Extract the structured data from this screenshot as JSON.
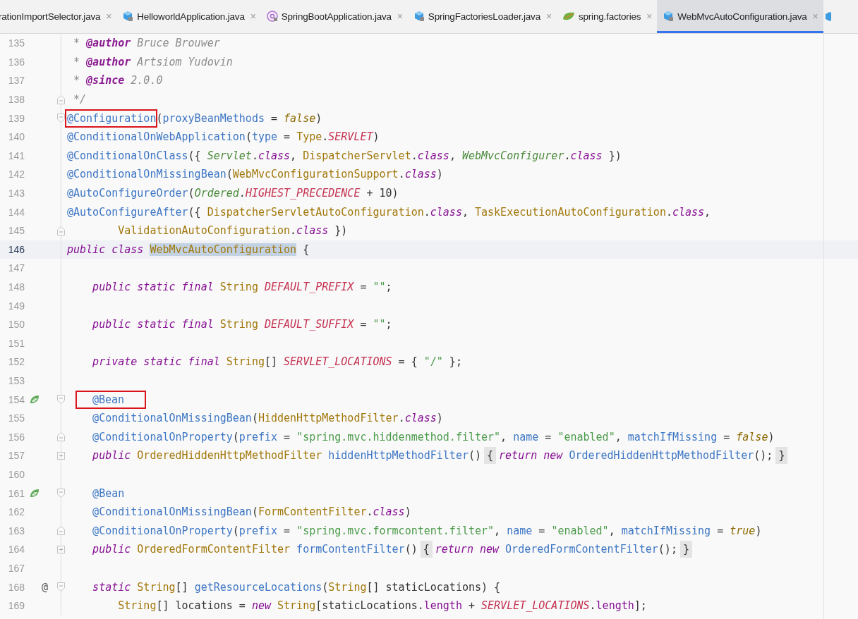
{
  "tabs": [
    {
      "label": "rationImportSelector.java",
      "kind": "none",
      "selected": false
    },
    {
      "label": "HelloworldApplication.java",
      "kind": "class",
      "selected": false
    },
    {
      "label": "SpringBootApplication.java",
      "kind": "annotation",
      "selected": false
    },
    {
      "label": "SpringFactoriesLoader.java",
      "kind": "class",
      "selected": false
    },
    {
      "label": "spring.factories",
      "kind": "spring",
      "selected": false
    },
    {
      "label": "WebMvcAutoConfiguration.java",
      "kind": "class",
      "selected": true
    }
  ],
  "close_glyph": "×",
  "lines": [
    {
      "number": "135",
      "current": false,
      "tokens": [
        {
          "text": " * ",
          "kind": "comment"
        },
        {
          "text": "@author",
          "kind": "doctag"
        },
        {
          "text": " Bruce Brouwer",
          "kind": "comment"
        }
      ]
    },
    {
      "number": "136",
      "current": false,
      "tokens": [
        {
          "text": " * ",
          "kind": "comment"
        },
        {
          "text": "@author",
          "kind": "doctag"
        },
        {
          "text": " Artsiom Yudovin",
          "kind": "comment"
        }
      ]
    },
    {
      "number": "137",
      "current": false,
      "tokens": [
        {
          "text": " * ",
          "kind": "comment"
        },
        {
          "text": "@since",
          "kind": "doctag"
        },
        {
          "text": " 2.0.0",
          "kind": "comment"
        }
      ]
    },
    {
      "number": "138",
      "current": false,
      "fold": {
        "kind": "end"
      },
      "tokens": [
        {
          "text": " */",
          "kind": "comment"
        }
      ]
    },
    {
      "number": "139",
      "current": false,
      "fold": {
        "kind": "start"
      },
      "tokens": [
        {
          "text": "@Configuration",
          "kind": "annotation-marked"
        },
        {
          "text": "(",
          "kind": "plain"
        },
        {
          "text": "proxyBeanMethods",
          "kind": "param"
        },
        {
          "text": " = ",
          "kind": "plain"
        },
        {
          "text": "false",
          "kind": "literal"
        },
        {
          "text": ")",
          "kind": "plain"
        }
      ]
    },
    {
      "number": "140",
      "current": false,
      "tokens": [
        {
          "text": "@ConditionalOnWebApplication",
          "kind": "annotation"
        },
        {
          "text": "(",
          "kind": "plain"
        },
        {
          "text": "type",
          "kind": "param"
        },
        {
          "text": " = ",
          "kind": "plain"
        },
        {
          "text": "Type",
          "kind": "type"
        },
        {
          "text": ".",
          "kind": "plain"
        },
        {
          "text": "SERVLET",
          "kind": "constant"
        },
        {
          "text": ")",
          "kind": "plain"
        }
      ]
    },
    {
      "number": "141",
      "current": false,
      "tokens": [
        {
          "text": "@ConditionalOnClass",
          "kind": "annotation"
        },
        {
          "text": "({ ",
          "kind": "plain"
        },
        {
          "text": "Servlet",
          "kind": "interface"
        },
        {
          "text": ".",
          "kind": "plain"
        },
        {
          "text": "class",
          "kind": "keyword"
        },
        {
          "text": ", ",
          "kind": "plain"
        },
        {
          "text": "DispatcherServlet",
          "kind": "type"
        },
        {
          "text": ".",
          "kind": "plain"
        },
        {
          "text": "class",
          "kind": "keyword"
        },
        {
          "text": ", ",
          "kind": "plain"
        },
        {
          "text": "WebMvcConfigurer",
          "kind": "interface"
        },
        {
          "text": ".",
          "kind": "plain"
        },
        {
          "text": "class",
          "kind": "keyword"
        },
        {
          "text": " })",
          "kind": "plain"
        }
      ]
    },
    {
      "number": "142",
      "current": false,
      "tokens": [
        {
          "text": "@ConditionalOnMissingBean",
          "kind": "annotation"
        },
        {
          "text": "(",
          "kind": "plain"
        },
        {
          "text": "WebMvcConfigurationSupport",
          "kind": "type"
        },
        {
          "text": ".",
          "kind": "plain"
        },
        {
          "text": "class",
          "kind": "keyword"
        },
        {
          "text": ")",
          "kind": "plain"
        }
      ]
    },
    {
      "number": "143",
      "current": false,
      "tokens": [
        {
          "text": "@AutoConfigureOrder",
          "kind": "annotation"
        },
        {
          "text": "(",
          "kind": "plain"
        },
        {
          "text": "Ordered",
          "kind": "interface"
        },
        {
          "text": ".",
          "kind": "plain"
        },
        {
          "text": "HIGHEST_PRECEDENCE",
          "kind": "constant"
        },
        {
          "text": " + ",
          "kind": "plain"
        },
        {
          "text": "10",
          "kind": "number"
        },
        {
          "text": ")",
          "kind": "plain"
        }
      ]
    },
    {
      "number": "144",
      "current": false,
      "tokens": [
        {
          "text": "@AutoConfigureAfter",
          "kind": "annotation"
        },
        {
          "text": "({ ",
          "kind": "plain"
        },
        {
          "text": "DispatcherServletAutoConfiguration",
          "kind": "type"
        },
        {
          "text": ".",
          "kind": "plain"
        },
        {
          "text": "class",
          "kind": "keyword"
        },
        {
          "text": ", ",
          "kind": "plain"
        },
        {
          "text": "TaskExecutionAutoConfiguration",
          "kind": "type"
        },
        {
          "text": ".",
          "kind": "plain"
        },
        {
          "text": "class",
          "kind": "keyword"
        },
        {
          "text": ",",
          "kind": "plain"
        }
      ]
    },
    {
      "number": "145",
      "current": false,
      "fold": {
        "kind": "end"
      },
      "tokens": [
        {
          "text": "        ValidationAutoConfiguration",
          "kind": "type"
        },
        {
          "text": ".",
          "kind": "plain"
        },
        {
          "text": "class",
          "kind": "keyword"
        },
        {
          "text": " })",
          "kind": "plain"
        }
      ]
    },
    {
      "number": "146",
      "current": true,
      "tokens": [
        {
          "text": "public class ",
          "kind": "keyword"
        },
        {
          "text": "WebMvcAutoConfiguration",
          "kind": "selected-type"
        },
        {
          "text": " {",
          "kind": "plain"
        }
      ]
    },
    {
      "number": "147",
      "current": false
    },
    {
      "number": "148",
      "current": false,
      "tokens": [
        {
          "text": "    public static final ",
          "kind": "keyword"
        },
        {
          "text": "String",
          "kind": "type"
        },
        {
          "text": " DEFAULT_PREFIX",
          "kind": "constant"
        },
        {
          "text": " = ",
          "kind": "plain"
        },
        {
          "text": "\"\"",
          "kind": "string"
        },
        {
          "text": ";",
          "kind": "plain"
        }
      ]
    },
    {
      "number": "149",
      "current": false
    },
    {
      "number": "150",
      "current": false,
      "tokens": [
        {
          "text": "    public static final ",
          "kind": "keyword"
        },
        {
          "text": "String",
          "kind": "type"
        },
        {
          "text": " DEFAULT_SUFFIX",
          "kind": "constant"
        },
        {
          "text": " = ",
          "kind": "plain"
        },
        {
          "text": "\"\"",
          "kind": "string"
        },
        {
          "text": ";",
          "kind": "plain"
        }
      ]
    },
    {
      "number": "151",
      "current": false
    },
    {
      "number": "152",
      "current": false,
      "tokens": [
        {
          "text": "    private static final ",
          "kind": "keyword"
        },
        {
          "text": "String",
          "kind": "type"
        },
        {
          "text": "[] ",
          "kind": "plain"
        },
        {
          "text": "SERVLET_LOCATIONS",
          "kind": "constant"
        },
        {
          "text": " = { ",
          "kind": "plain"
        },
        {
          "text": "\"/\"",
          "kind": "string"
        },
        {
          "text": " };",
          "kind": "plain"
        }
      ]
    },
    {
      "number": "153",
      "current": false
    },
    {
      "number": "154",
      "current": false,
      "gutter_icon": {
        "kind": "bean"
      },
      "fold": {
        "kind": "start"
      },
      "tokens": [
        {
          "text": "@Bean",
          "kind": "annotation-marked-indented"
        }
      ]
    },
    {
      "number": "155",
      "current": false,
      "tokens": [
        {
          "text": "    @ConditionalOnMissingBean",
          "kind": "annotation"
        },
        {
          "text": "(",
          "kind": "plain"
        },
        {
          "text": "HiddenHttpMethodFilter",
          "kind": "type"
        },
        {
          "text": ".",
          "kind": "plain"
        },
        {
          "text": "class",
          "kind": "keyword"
        },
        {
          "text": ")",
          "kind": "plain"
        }
      ]
    },
    {
      "number": "156",
      "current": false,
      "fold": {
        "kind": "end"
      },
      "tokens": [
        {
          "text": "    @ConditionalOnProperty",
          "kind": "annotation"
        },
        {
          "text": "(",
          "kind": "plain"
        },
        {
          "text": "prefix",
          "kind": "param"
        },
        {
          "text": " = ",
          "kind": "plain"
        },
        {
          "text": "\"spring.mvc.hiddenmethod.filter\"",
          "kind": "string"
        },
        {
          "text": ", ",
          "kind": "plain"
        },
        {
          "text": "name",
          "kind": "param"
        },
        {
          "text": " = ",
          "kind": "plain"
        },
        {
          "text": "\"enabled\"",
          "kind": "string"
        },
        {
          "text": ", ",
          "kind": "plain"
        },
        {
          "text": "matchIfMissing",
          "kind": "param"
        },
        {
          "text": " = ",
          "kind": "plain"
        },
        {
          "text": "false",
          "kind": "literal"
        },
        {
          "text": ")",
          "kind": "plain"
        }
      ]
    },
    {
      "number": "157",
      "current": false,
      "fold": {
        "kind": "collapsed"
      },
      "tokens": [
        {
          "text": "    public ",
          "kind": "keyword"
        },
        {
          "text": "OrderedHiddenHttpMethodFilter",
          "kind": "type"
        },
        {
          "text": " hiddenHttpMethodFilter",
          "kind": "method"
        },
        {
          "text": "()",
          "kind": "plain"
        },
        {
          "text": "{",
          "kind": "fold-brace"
        },
        {
          "text": "return new ",
          "kind": "keyword"
        },
        {
          "text": "OrderedHiddenHttpMethodFilter",
          "kind": "method"
        },
        {
          "text": "();",
          "kind": "plain"
        },
        {
          "text": "}",
          "kind": "fold-brace"
        }
      ]
    },
    {
      "number": "160",
      "current": false
    },
    {
      "number": "161",
      "current": false,
      "gutter_icon": {
        "kind": "bean"
      },
      "fold": {
        "kind": "start"
      },
      "tokens": [
        {
          "text": "    @Bean",
          "kind": "annotation"
        }
      ]
    },
    {
      "number": "162",
      "current": false,
      "tokens": [
        {
          "text": "    @ConditionalOnMissingBean",
          "kind": "annotation"
        },
        {
          "text": "(",
          "kind": "plain"
        },
        {
          "text": "FormContentFilter",
          "kind": "type"
        },
        {
          "text": ".",
          "kind": "plain"
        },
        {
          "text": "class",
          "kind": "keyword"
        },
        {
          "text": ")",
          "kind": "plain"
        }
      ]
    },
    {
      "number": "163",
      "current": false,
      "fold": {
        "kind": "end"
      },
      "tokens": [
        {
          "text": "    @ConditionalOnProperty",
          "kind": "annotation"
        },
        {
          "text": "(",
          "kind": "plain"
        },
        {
          "text": "prefix",
          "kind": "param"
        },
        {
          "text": " = ",
          "kind": "plain"
        },
        {
          "text": "\"spring.mvc.formcontent.filter\"",
          "kind": "string"
        },
        {
          "text": ", ",
          "kind": "plain"
        },
        {
          "text": "name",
          "kind": "param"
        },
        {
          "text": " = ",
          "kind": "plain"
        },
        {
          "text": "\"enabled\"",
          "kind": "string"
        },
        {
          "text": ", ",
          "kind": "plain"
        },
        {
          "text": "matchIfMissing",
          "kind": "param"
        },
        {
          "text": " = ",
          "kind": "plain"
        },
        {
          "text": "true",
          "kind": "literal"
        },
        {
          "text": ")",
          "kind": "plain"
        }
      ]
    },
    {
      "number": "164",
      "current": false,
      "fold": {
        "kind": "collapsed"
      },
      "tokens": [
        {
          "text": "    public ",
          "kind": "keyword"
        },
        {
          "text": "OrderedFormContentFilter",
          "kind": "type"
        },
        {
          "text": " formContentFilter",
          "kind": "method"
        },
        {
          "text": "()",
          "kind": "plain"
        },
        {
          "text": "{",
          "kind": "fold-brace"
        },
        {
          "text": "return new ",
          "kind": "keyword"
        },
        {
          "text": "OrderedFormContentFilter",
          "kind": "method"
        },
        {
          "text": "();",
          "kind": "plain"
        },
        {
          "text": "}",
          "kind": "fold-brace"
        }
      ]
    },
    {
      "number": "167",
      "current": false
    },
    {
      "number": "168",
      "current": false,
      "gutter_text": "@",
      "fold": {
        "kind": "start"
      },
      "tokens": [
        {
          "text": "    static ",
          "kind": "keyword"
        },
        {
          "text": "String",
          "kind": "type"
        },
        {
          "text": "[] ",
          "kind": "plain"
        },
        {
          "text": "getResourceLocations",
          "kind": "method"
        },
        {
          "text": "(",
          "kind": "plain"
        },
        {
          "text": "String",
          "kind": "type"
        },
        {
          "text": "[] staticLocations) {",
          "kind": "plain"
        }
      ]
    },
    {
      "number": "169",
      "current": false,
      "tokens": [
        {
          "text": "        String",
          "kind": "type"
        },
        {
          "text": "[] locations = ",
          "kind": "plain"
        },
        {
          "text": "new ",
          "kind": "keyword"
        },
        {
          "text": "String",
          "kind": "type"
        },
        {
          "text": "[staticLocations.",
          "kind": "plain"
        },
        {
          "text": "length",
          "kind": "field"
        },
        {
          "text": " + ",
          "kind": "plain"
        },
        {
          "text": "SERVLET_LOCATIONS",
          "kind": "constant"
        },
        {
          "text": ".",
          "kind": "plain"
        },
        {
          "text": "length",
          "kind": "field"
        },
        {
          "text": "];",
          "kind": "plain"
        }
      ]
    }
  ]
}
